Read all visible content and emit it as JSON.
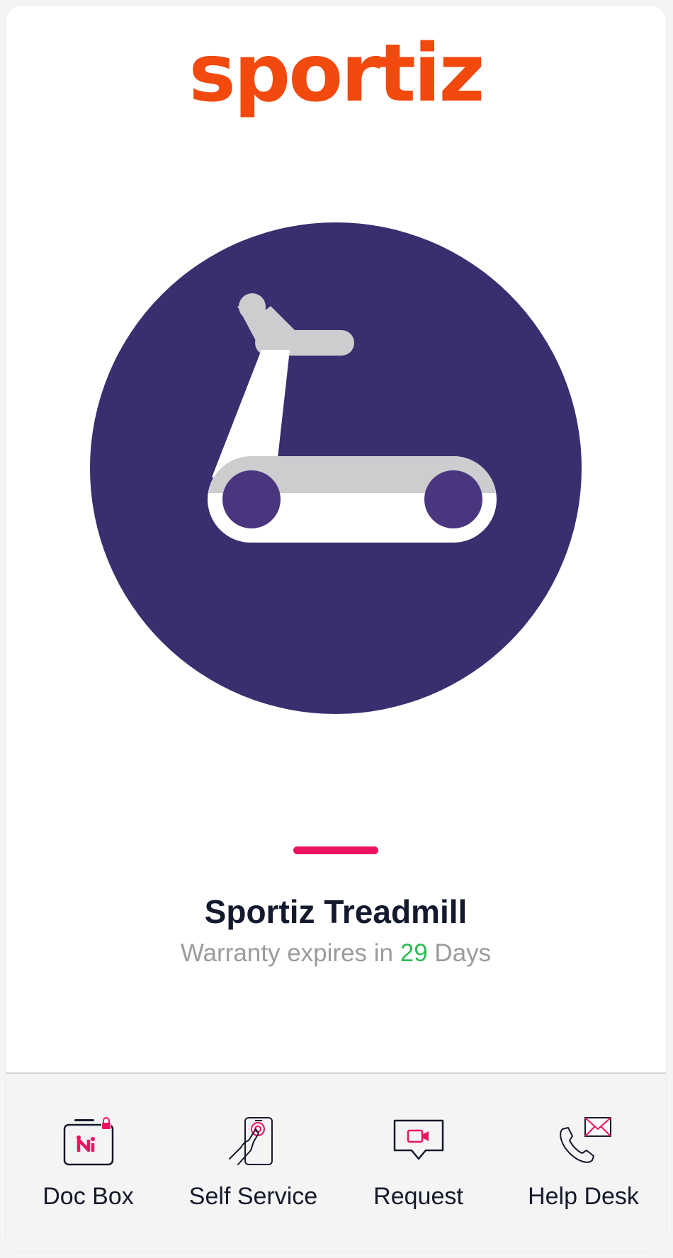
{
  "brand": {
    "logo_text": "sportiz",
    "logo_color": "#f2490f"
  },
  "product": {
    "name": "Sportiz Treadmill",
    "icon": "treadmill-icon",
    "icon_bg_color": "#3a2e6e"
  },
  "warranty": {
    "prefix": "Warranty expires in",
    "days": "29",
    "suffix": "Days"
  },
  "accent_color": "#ec1361",
  "tabs": [
    {
      "label": "Doc Box",
      "icon": "doc-box-lock-icon"
    },
    {
      "label": "Self Service",
      "icon": "phone-touch-icon"
    },
    {
      "label": "Request",
      "icon": "video-chat-icon"
    },
    {
      "label": "Help Desk",
      "icon": "phone-mail-icon"
    }
  ]
}
